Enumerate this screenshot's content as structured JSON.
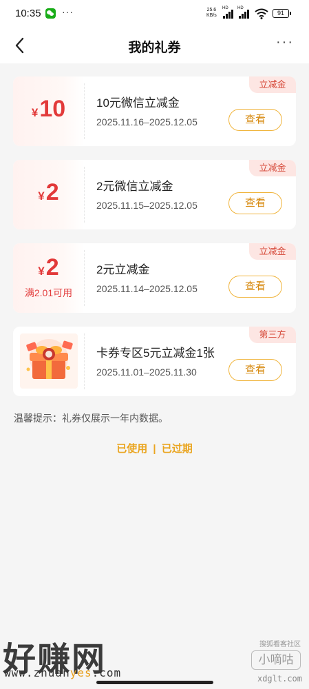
{
  "status_bar": {
    "time": "10:35",
    "dots": "···",
    "net_speed_value": "25.6",
    "net_speed_unit": "KB/s",
    "hd1": "HD",
    "hd2": "HD",
    "battery": "91"
  },
  "header": {
    "title": "我的礼券",
    "more": "···"
  },
  "coupons": [
    {
      "currency": "¥",
      "amount": "10",
      "condition": "",
      "title": "10元微信立减金",
      "date_range": "2025.11.16–2025.12.05",
      "tag": "立减金",
      "button": "查看"
    },
    {
      "currency": "¥",
      "amount": "2",
      "condition": "",
      "title": "2元微信立减金",
      "date_range": "2025.11.15–2025.12.05",
      "tag": "立减金",
      "button": "查看"
    },
    {
      "currency": "¥",
      "amount": "2",
      "condition": "满2.01可用",
      "title": "2元立减金",
      "date_range": "2025.11.14–2025.12.05",
      "tag": "立减金",
      "button": "查看"
    },
    {
      "image_icon": "gift-box-icon",
      "title": "卡券专区5元立减金1张",
      "date_range": "2025.11.01–2025.11.30",
      "tag": "第三方",
      "button": "查看"
    }
  ],
  "notice": "温馨提示：礼券仅展示一年内数据。",
  "history": {
    "used": "已使用",
    "separator": "|",
    "expired": "已过期"
  },
  "watermark": {
    "left_big": "好赚网",
    "left_url_a": "www.zhuan",
    "left_url_b": "yes",
    "left_url_c": ".com",
    "right_small": "搜狐看客社区",
    "right_big": "小嘀咕",
    "right_url": "xdglt.com"
  },
  "colors": {
    "accent_red": "#e23a3a",
    "button_border": "#f0b43c",
    "link_orange": "#eaa520",
    "tag_bg": "#fde6e3"
  }
}
